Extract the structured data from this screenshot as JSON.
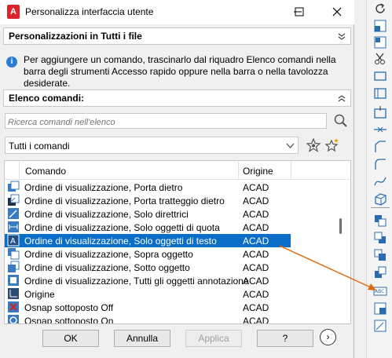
{
  "window": {
    "title": "Personalizza interfaccia utente",
    "app_icon": "A",
    "minimize": "─",
    "close": "✕"
  },
  "section1": {
    "title": "Personalizzazioni in Tutti i file",
    "chevron": "»"
  },
  "info": {
    "icon": "i",
    "text": "Per aggiungere un comando, trascinarlo dal riquadro Elenco comandi nella barra degli strumenti Accesso rapido oppure nella barra o nella tavolozza desiderate."
  },
  "section2": {
    "title": "Elenco comandi:",
    "chevron": "«"
  },
  "search": {
    "placeholder": "Ricerca comandi nell'elenco"
  },
  "filter": {
    "value": "Tutti i comandi"
  },
  "table": {
    "headers": {
      "command": "Comando",
      "origin": "Origine"
    },
    "rows": [
      {
        "name": "Ordine di visualizzazione, Porta dietro",
        "origin": "ACAD"
      },
      {
        "name": "Ordine di visualizzazione, Porta tratteggio dietro",
        "origin": "ACAD"
      },
      {
        "name": "Ordine di visualizzazione, Solo direttrici",
        "origin": "ACAD"
      },
      {
        "name": "Ordine di visualizzazione, Solo oggetti di quota",
        "origin": "ACAD"
      },
      {
        "name": "Ordine di visualizzazione, Solo oggetti di testo",
        "origin": "ACAD",
        "selected": true
      },
      {
        "name": "Ordine di visualizzazione, Sopra oggetto",
        "origin": "ACAD"
      },
      {
        "name": "Ordine di visualizzazione, Sotto oggetto",
        "origin": "ACAD"
      },
      {
        "name": "Ordine di visualizzazione, Tutti gli oggetti annotazione",
        "origin": "ACAD"
      },
      {
        "name": "Origine",
        "origin": "ACAD"
      },
      {
        "name": "Osnap sottoposto Off",
        "origin": "ACAD"
      },
      {
        "name": "Osnap sottoposto On",
        "origin": "ACAD"
      }
    ]
  },
  "buttons": {
    "ok": "OK",
    "cancel": "Annulla",
    "apply": "Applica",
    "help": "?",
    "next": "›"
  },
  "colors": {
    "selection": "#0a6ec8",
    "arrow": "#e06a10",
    "app_icon": "#d9262c"
  }
}
